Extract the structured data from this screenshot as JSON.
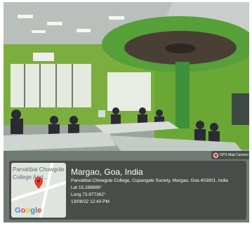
{
  "photo": {
    "subject": "computer laboratory interior"
  },
  "badge": {
    "label": "GPS Map Camera",
    "icon": "location-pin-icon"
  },
  "map": {
    "label": "Parvatibai Chowgule College And...",
    "pin_icon": "location-pin-icon",
    "brand": "Google",
    "brand_letters": [
      "G",
      "o",
      "o",
      "g",
      "l",
      "e"
    ],
    "brand_colors": [
      "#4285f4",
      "#ea4335",
      "#fbbc05",
      "#4285f4",
      "#34a853",
      "#ea4335"
    ]
  },
  "location": {
    "title": "Margao, Goa, India",
    "address": "Parvatibai Chowgule College, Cupangale Society, Margao, Goa 403601, India",
    "lat": "Lat 15.288889°",
    "long": "Long 73.977362°",
    "timestamp": "13/08/22 12:43 PM"
  }
}
